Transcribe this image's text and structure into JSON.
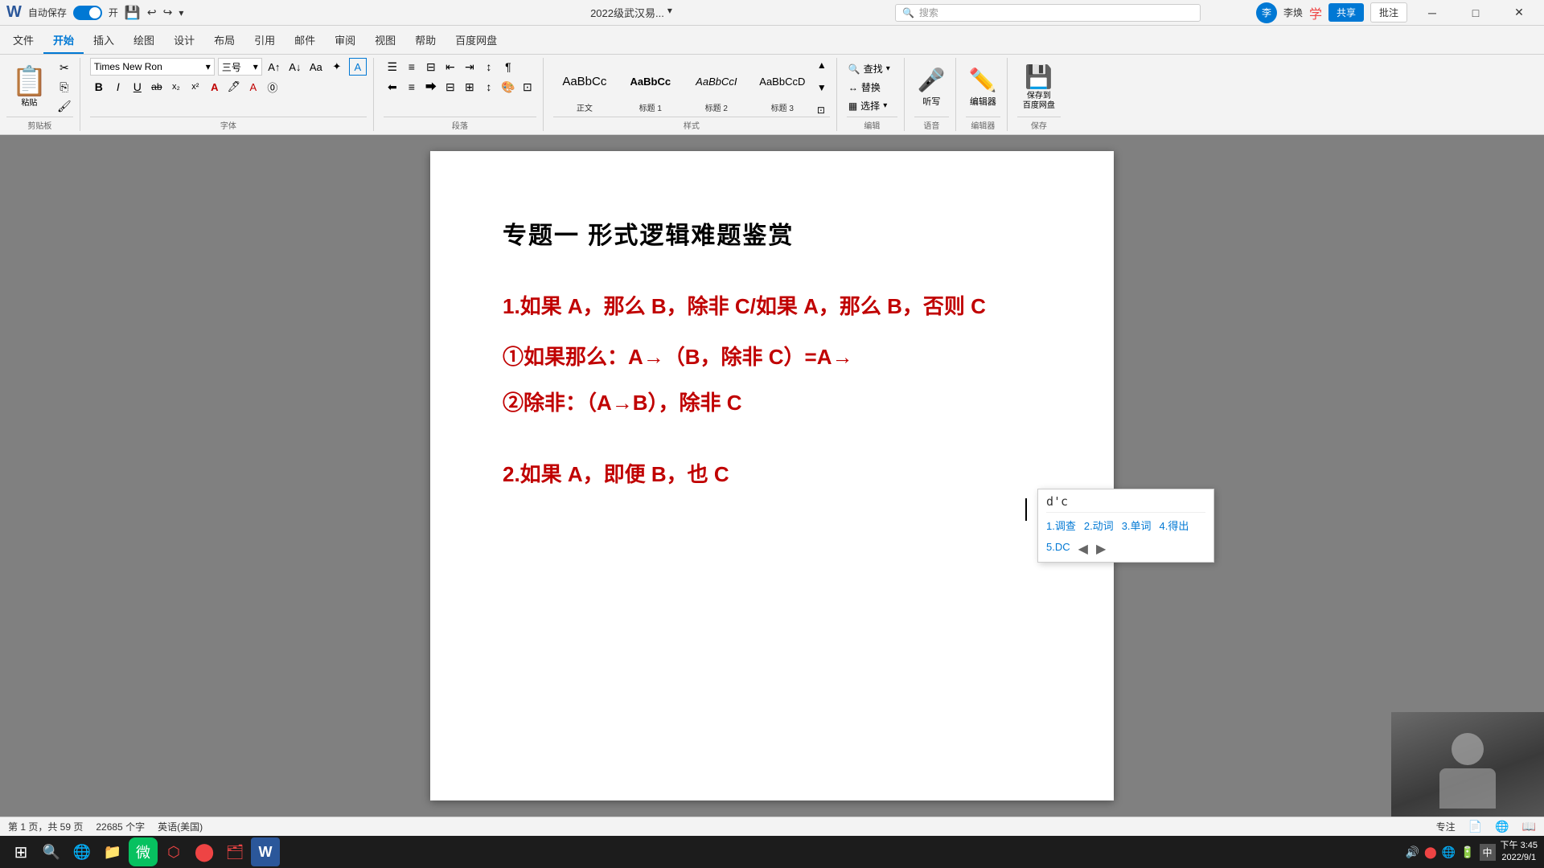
{
  "titlebar": {
    "autosave_label": "自动保存",
    "autosave_state": "开",
    "doc_title": "2022级武汉易...",
    "search_placeholder": "搜索",
    "user_name": "李焕",
    "share_label": "共享",
    "comment_label": "批注",
    "min_label": "─",
    "max_label": "□",
    "close_label": "✕"
  },
  "ribbon": {
    "tabs": [
      {
        "label": "文件"
      },
      {
        "label": "开始",
        "active": true
      },
      {
        "label": "插入"
      },
      {
        "label": "绘图"
      },
      {
        "label": "设计"
      },
      {
        "label": "布局"
      },
      {
        "label": "引用"
      },
      {
        "label": "邮件"
      },
      {
        "label": "审阅"
      },
      {
        "label": "视图"
      },
      {
        "label": "帮助"
      },
      {
        "label": "百度网盘"
      }
    ],
    "groups": {
      "clipboard": {
        "label": "剪贴板",
        "paste_label": "粘贴",
        "cut_icon": "✂",
        "copy_icon": "⎘",
        "format_icon": "🖌"
      },
      "font": {
        "label": "字体",
        "font_name": "Times New Ron",
        "font_size": "三号",
        "bold": "B",
        "italic": "I",
        "underline": "U"
      },
      "paragraph": {
        "label": "段落"
      },
      "styles": {
        "label": "样式",
        "items": [
          {
            "label": "正文",
            "preview": "AaBbCc"
          },
          {
            "label": "标题 1",
            "preview": "AaBbCc"
          },
          {
            "label": "标题 2",
            "preview": "AaBbCcI"
          },
          {
            "label": "标题 3",
            "preview": "AaBbCcD"
          }
        ]
      },
      "edit": {
        "label": "编辑",
        "find_label": "查找",
        "replace_label": "替换",
        "select_label": "选择"
      },
      "dictation": {
        "label": "语音",
        "dictate_label": "听写"
      },
      "editor": {
        "label": "编辑器",
        "editor_label": "编辑器"
      },
      "save": {
        "label": "保存",
        "save_local": "保存到\n百度网盘"
      }
    }
  },
  "document": {
    "title": "专题一  形式逻辑难题鉴赏",
    "lines": [
      {
        "text": "1.如果 A，那么 B，除非 C/如果 A，那么 B，否则 C",
        "type": "heading"
      },
      {
        "text": "①如果那么：A→（B，除非 C）=A→",
        "type": "sub",
        "number": "①"
      },
      {
        "text": "②除非：（A→B），除非 C",
        "type": "sub",
        "number": "②"
      },
      {
        "text": "2.如果 A，即便 B，也 C",
        "type": "heading"
      }
    ]
  },
  "popup": {
    "input_text": "d'c",
    "options": [
      {
        "label": "1.调查"
      },
      {
        "label": "2.动词"
      },
      {
        "label": "3.单词"
      },
      {
        "label": "4.得出"
      },
      {
        "label": "5.DC"
      }
    ]
  },
  "statusbar": {
    "page_info": "第 1 页，共 59 页",
    "word_count": "22685 个字",
    "language": "英语(美国)",
    "focus_label": "专注",
    "view_options": ""
  },
  "taskbar": {
    "icons": [
      "⊞",
      "🔍",
      "🌐",
      "📁",
      "📧",
      "🇨",
      "⬡",
      "⬤",
      "W"
    ],
    "time": "下午",
    "date": "2022/9/1"
  }
}
